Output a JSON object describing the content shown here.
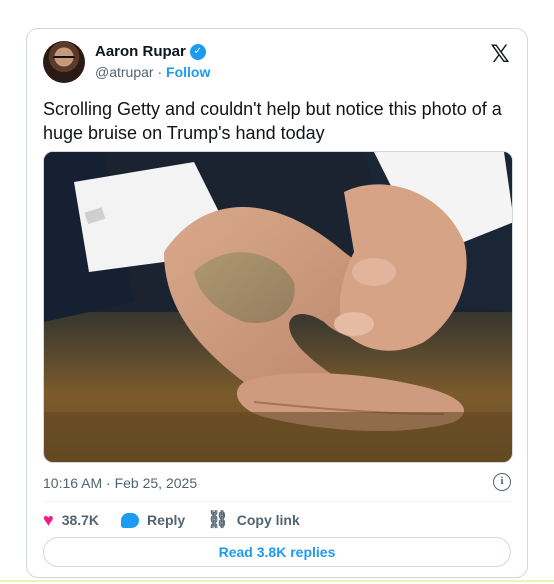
{
  "author": {
    "name": "Aaron Rupar",
    "handle": "@atrupar",
    "separator": "·",
    "follow_label": "Follow",
    "verified_icon": "verified-badge-icon"
  },
  "brand_icon": "x-logo-icon",
  "tweet": {
    "text": "Scrolling Getty and couldn't help but notice this photo of a huge bruise on Trump's hand today",
    "timestamp": "10:16 AM · Feb 25, 2025"
  },
  "actions": {
    "likes": "38.7K",
    "reply_label": "Reply",
    "copy_link_label": "Copy link"
  },
  "read_replies_label": "Read 3.8K replies",
  "colors": {
    "accent": "#1d9bf0",
    "like": "#f91880",
    "text": "#0f1419",
    "muted": "#536471",
    "border": "#cfd9de"
  }
}
